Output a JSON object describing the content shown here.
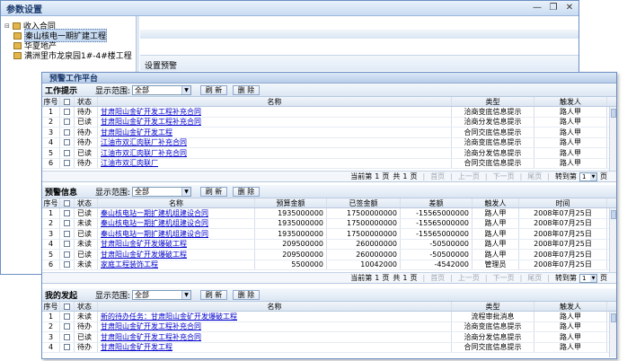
{
  "back_window": {
    "title": "参数设置",
    "controls": [
      "—",
      "❐",
      "✕"
    ],
    "tree": [
      {
        "label": "收入合同",
        "level": 0
      },
      {
        "label": "秦山核电一期扩建工程",
        "level": 1,
        "selected": true
      },
      {
        "label": "华夏地产",
        "level": 1
      },
      {
        "label": "满洲里市龙泉园1#-4#楼工程",
        "level": 1
      }
    ],
    "right_label": "设置预警"
  },
  "front_window": {
    "title": "预警工作平台",
    "range_label": "显示范围:",
    "range_value": "全部",
    "refresh_label": "刷 新",
    "delete_label": "删 除",
    "pager": {
      "current_prefix": "当前第",
      "current": "1",
      "page_word": "页",
      "total_prefix": "共",
      "total": "1",
      "first": "首页",
      "prev": "上一页",
      "next": "下一页",
      "last": "尾页",
      "goto": "转到第",
      "goto_value": "1",
      "goto_suffix": "页"
    }
  },
  "work_hint": {
    "name": "工作提示",
    "columns": [
      "序号",
      "",
      "状态",
      "名称",
      "类型",
      "触发人"
    ],
    "rows": [
      {
        "no": "1",
        "status": "待办",
        "name": "甘肃阳山金矿开发工程补充合同",
        "type": "洽商变底信息提示",
        "trigger": "路人甲"
      },
      {
        "no": "2",
        "status": "已读",
        "name": "甘肃阳山金矿开发工程补充合同",
        "type": "洽商分发信息提示",
        "trigger": "路人甲"
      },
      {
        "no": "3",
        "status": "待办",
        "name": "甘肃阳山金矿开发工程",
        "type": "合同交底信息提示",
        "trigger": "路人甲"
      },
      {
        "no": "4",
        "status": "待办",
        "name": "江油市双汇肉联厂补充合同",
        "type": "洽商变底信息提示",
        "trigger": "路人甲"
      },
      {
        "no": "5",
        "status": "已读",
        "name": "江油市双汇肉联厂补充合同",
        "type": "洽商分发信息提示",
        "trigger": "路人甲"
      },
      {
        "no": "6",
        "status": "待办",
        "name": "江油市双汇肉联厂",
        "type": "合同交底信息提示",
        "trigger": "路人甲"
      }
    ]
  },
  "alert_info": {
    "name": "预警信息",
    "columns": [
      "序号",
      "",
      "状态",
      "名称",
      "预算金额",
      "已签金额",
      "差额",
      "触发人",
      "时间"
    ],
    "rows": [
      {
        "no": "1",
        "status": "已读",
        "name": "秦山核电站一期扩建机组建设合同",
        "budget": "1935000000",
        "signed": "17500000000",
        "diff": "-15565000000",
        "trigger": "路人甲",
        "time": "2008年07月25日"
      },
      {
        "no": "2",
        "status": "未读",
        "name": "秦山核电站一期扩建机组建设合同",
        "budget": "1935000000",
        "signed": "17500000000",
        "diff": "-15565000000",
        "trigger": "路人甲",
        "time": "2008年07月25日"
      },
      {
        "no": "3",
        "status": "已读",
        "name": "秦山核电站一期扩建机组建设合同",
        "budget": "1935000000",
        "signed": "17500000000",
        "diff": "-15565000000",
        "trigger": "路人甲",
        "time": "2008年07月25日"
      },
      {
        "no": "4",
        "status": "未读",
        "name": "甘肃阳山金矿开发爆破工程",
        "budget": "209500000",
        "signed": "260000000",
        "diff": "-50500000",
        "trigger": "路人甲",
        "time": "2008年07月25日"
      },
      {
        "no": "5",
        "status": "已读",
        "name": "甘肃阳山金矿开发爆破工程",
        "budget": "209500000",
        "signed": "260000000",
        "diff": "-50500000",
        "trigger": "路人甲",
        "time": "2008年07月25日"
      },
      {
        "no": "6",
        "status": "未读",
        "name": "家庭工程装饰工程",
        "budget": "5500000",
        "signed": "10042000",
        "diff": "-4542000",
        "trigger": "管理员",
        "time": "2008年07月25日"
      }
    ]
  },
  "my_initiated": {
    "name": "我的发起",
    "columns": [
      "序号",
      "",
      "状态",
      "名称",
      "类型",
      "触发人"
    ],
    "rows": [
      {
        "no": "1",
        "status": "未读",
        "name": "新的待办任务：甘肃阳山金矿开发爆破工程",
        "type": "流程审批消息",
        "trigger": "路人甲"
      },
      {
        "no": "2",
        "status": "待办",
        "name": "甘肃阳山金矿开发工程补充合同",
        "type": "洽商变底信息提示",
        "trigger": "路人甲"
      },
      {
        "no": "3",
        "status": "已读",
        "name": "甘肃阳山金矿开发工程补充合同",
        "type": "洽商分发信息提示",
        "trigger": "路人甲"
      },
      {
        "no": "4",
        "status": "待办",
        "name": "甘肃阳山金矿开发工程",
        "type": "合同交底信息提示",
        "trigger": "路人甲"
      }
    ]
  }
}
